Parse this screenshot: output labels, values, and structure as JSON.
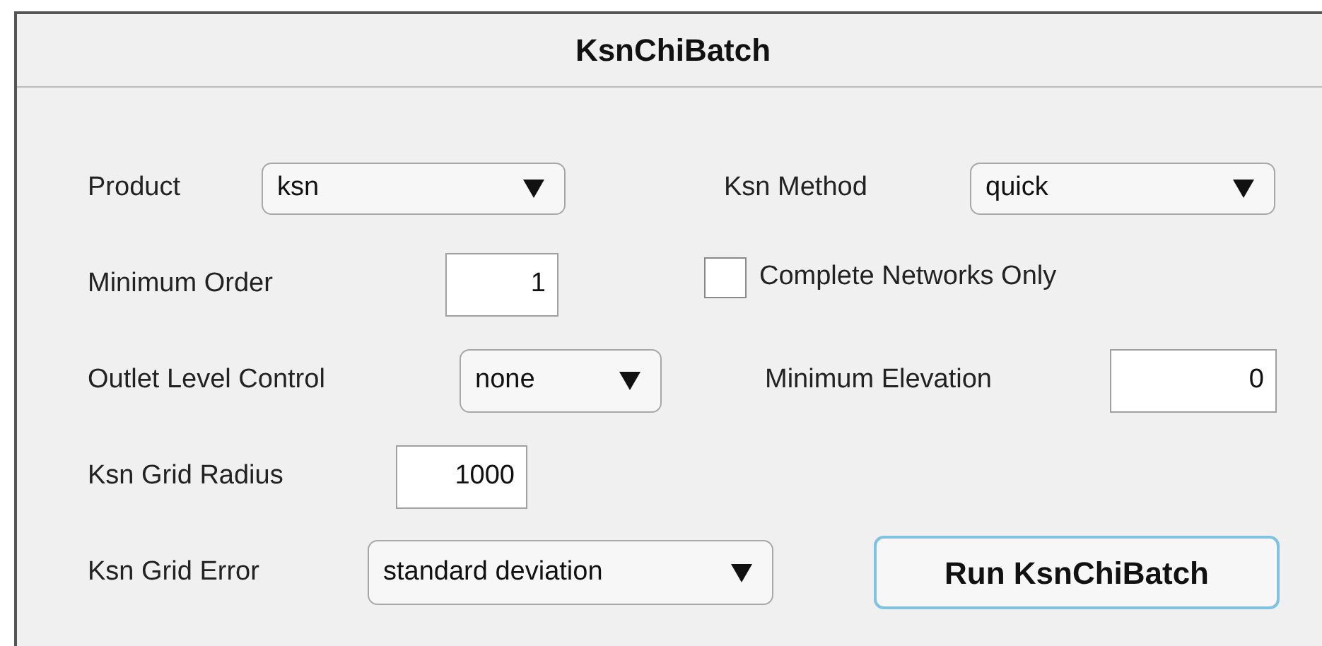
{
  "panel": {
    "title": "KsnChiBatch"
  },
  "rows": [
    [
      {
        "kind": "label",
        "text": "Product"
      },
      {
        "kind": "dropdown",
        "value": "ksn"
      },
      {
        "kind": "label",
        "text": "Ksn Method"
      },
      {
        "kind": "dropdown",
        "value": "quick"
      }
    ],
    [
      {
        "kind": "label",
        "text": "Minimum Order"
      },
      {
        "kind": "field",
        "value": "1"
      },
      {
        "kind": "checkbox",
        "label": "Complete Networks Only",
        "checked": false
      }
    ],
    [
      {
        "kind": "label",
        "text": "Outlet Level Control"
      },
      {
        "kind": "dropdown",
        "value": "none"
      },
      {
        "kind": "label",
        "text": "Minimum Elevation"
      },
      {
        "kind": "field",
        "value": "0"
      }
    ],
    [
      {
        "kind": "label",
        "text": "Ksn Grid Radius"
      },
      {
        "kind": "field",
        "value": "1000"
      }
    ],
    [
      {
        "kind": "label",
        "text": "Ksn Grid Error"
      },
      {
        "kind": "dropdown",
        "value": "standard deviation"
      },
      {
        "kind": "button",
        "label": "Run KsnChiBatch"
      }
    ]
  ]
}
